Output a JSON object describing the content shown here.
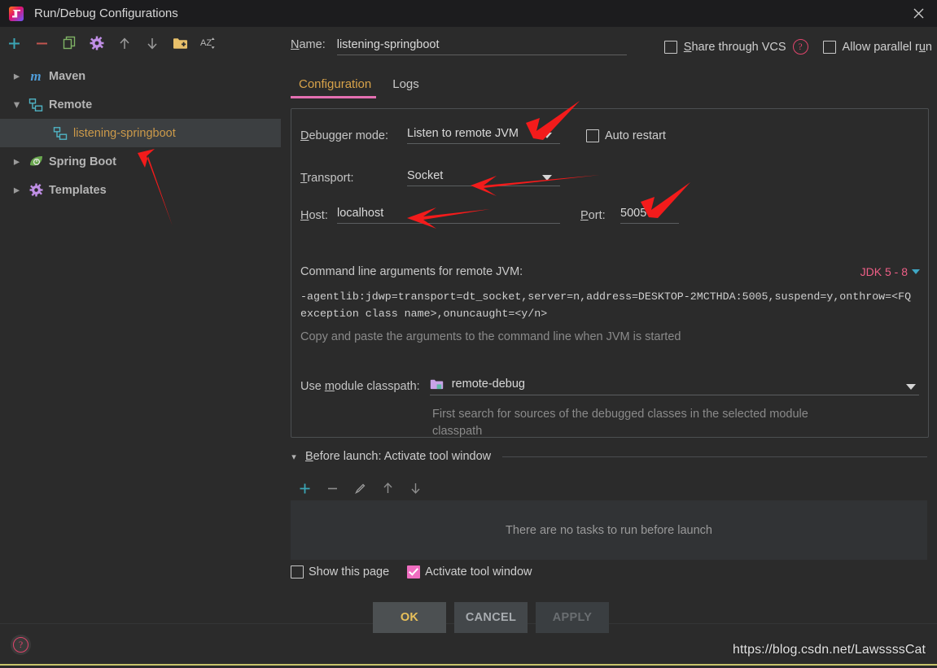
{
  "window": {
    "title": "Run/Debug Configurations",
    "app_icon": "intellij-idea-icon",
    "close_label": "×"
  },
  "toolbar": {
    "items": [
      {
        "name": "add-configuration-button",
        "icon": "plus-icon",
        "label": "+"
      },
      {
        "name": "remove-configuration-button",
        "icon": "minus-icon",
        "label": "−"
      },
      {
        "name": "copy-configuration-button",
        "icon": "copy-icon",
        "label": "Copy"
      },
      {
        "name": "edit-templates-button",
        "icon": "gear-icon",
        "label": "Edit Templates"
      },
      {
        "name": "move-up-button",
        "icon": "arrow-up-icon",
        "label": "Move Up"
      },
      {
        "name": "move-down-button",
        "icon": "arrow-down-icon",
        "label": "Move Down"
      },
      {
        "name": "new-folder-button",
        "icon": "folder-plus-icon",
        "label": "New Folder"
      },
      {
        "name": "sort-configurations-button",
        "icon": "sort-alphabetically-icon",
        "label": "Sort"
      }
    ]
  },
  "sidebar": {
    "items": [
      {
        "label": "Maven",
        "icon": "maven-icon",
        "expanded": false,
        "selected": false,
        "child": false
      },
      {
        "label": "Remote",
        "icon": "remote-icon",
        "expanded": true,
        "selected": false,
        "child": false
      },
      {
        "label": "listening-springboot",
        "icon": "remote-icon",
        "expanded": null,
        "selected": true,
        "child": true
      },
      {
        "label": "Spring Boot",
        "icon": "spring-boot-icon",
        "expanded": false,
        "selected": false,
        "child": false
      },
      {
        "label": "Templates",
        "icon": "gear-icon",
        "expanded": false,
        "selected": false,
        "child": false
      }
    ]
  },
  "form": {
    "name_label": "Name:",
    "name_value": "listening-springboot",
    "share_vcs_label": "Share through VCS",
    "share_vcs_checked": false,
    "share_vcs_help_icon": "question-mark-icon",
    "allow_parallel_label": "Allow parallel run",
    "allow_parallel_checked": false
  },
  "tabs": [
    {
      "label": "Configuration",
      "active": true
    },
    {
      "label": "Logs",
      "active": false
    }
  ],
  "configuration": {
    "debugger_mode_label": "Debugger mode:",
    "debugger_mode_value": "Listen to remote JVM",
    "auto_restart_label": "Auto restart",
    "auto_restart_checked": false,
    "transport_label": "Transport:",
    "transport_value": "Socket",
    "host_label": "Host:",
    "host_value": "localhost",
    "port_label": "Port:",
    "port_value": "5005",
    "args_title": "Command line arguments for remote JVM:",
    "jdk_version_label": "JDK 5 - 8",
    "args_value": "-agentlib:jdwp=transport=dt_socket,server=n,address=DESKTOP-2MCTHDA:5005,suspend=y,onthrow=<FQ exception class name>,onuncaught=<y/n>",
    "args_hint": "Copy and paste the arguments to the command line when JVM is started",
    "module_classpath_label": "Use module classpath:",
    "module_classpath_value": "remote-debug",
    "module_classpath_icon": "module-folder-icon",
    "module_hint": "First search for sources of the debugged classes in the selected module classpath"
  },
  "before_launch": {
    "title": "Before launch: Activate tool window",
    "expanded": true,
    "tools": [
      {
        "name": "add-task-button",
        "icon": "plus-icon"
      },
      {
        "name": "remove-task-button",
        "icon": "minus-icon"
      },
      {
        "name": "edit-task-button",
        "icon": "pencil-icon"
      },
      {
        "name": "move-task-up-button",
        "icon": "arrow-up-icon"
      },
      {
        "name": "move-task-down-button",
        "icon": "arrow-down-icon"
      }
    ],
    "empty_text": "There are no tasks to run before launch",
    "show_this_page_label": "Show this page",
    "show_this_page_checked": false,
    "activate_tool_window_label": "Activate tool window",
    "activate_tool_window_checked": true
  },
  "buttons": {
    "ok": "OK",
    "cancel": "CANCEL",
    "apply": "APPLY",
    "help_icon": "question-mark-icon"
  },
  "watermark": "https://blog.csdn.net/LawssssCat",
  "colors": {
    "accent_pink": "#f06ec1",
    "selected_item": "#cc9a4a",
    "tab_active": "#d8a34a",
    "annotation_arrow": "#f31b1b",
    "ok_button_text": "#e8c05a",
    "jdk_label": "#ef5f87"
  }
}
